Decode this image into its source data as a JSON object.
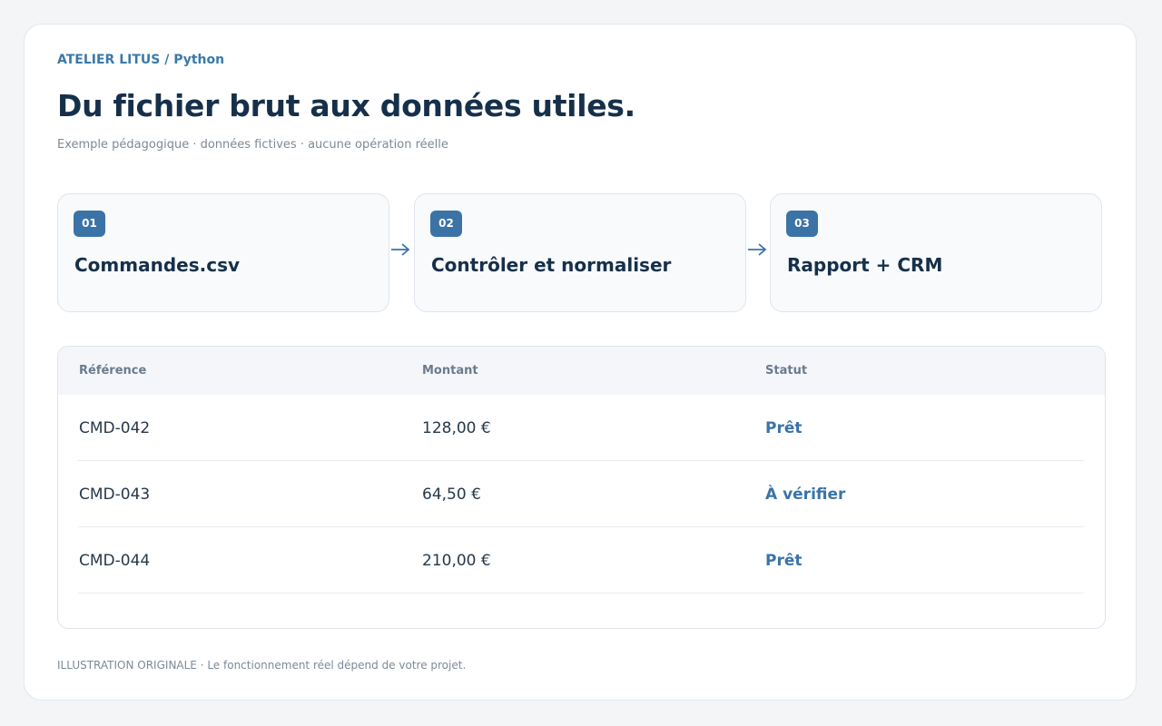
{
  "header": {
    "crumb": "ATELIER LITUS / Python",
    "title": "Du fichier brut aux données utiles.",
    "subtitle": "Exemple pédagogique · données fictives · aucune opération réelle"
  },
  "steps": [
    {
      "num": "01",
      "label": "Commandes.csv"
    },
    {
      "num": "02",
      "label": "Contrôler et normaliser"
    },
    {
      "num": "03",
      "label": "Rapport + CRM"
    }
  ],
  "table": {
    "columns": [
      "Référence",
      "Montant",
      "Statut"
    ],
    "rows": [
      {
        "reference": "CMD-042",
        "montant": "128,00 €",
        "statut": "Prêt"
      },
      {
        "reference": "CMD-043",
        "montant": "64,50 €",
        "statut": "À vérifier"
      },
      {
        "reference": "CMD-044",
        "montant": "210,00 €",
        "statut": "Prêt"
      }
    ]
  },
  "footer": "ILLUSTRATION ORIGINALE · Le fonctionnement réel dépend de votre projet.",
  "colors": {
    "accent": "#3b73a7",
    "title": "#16304a",
    "background": "#f3f5f7"
  }
}
